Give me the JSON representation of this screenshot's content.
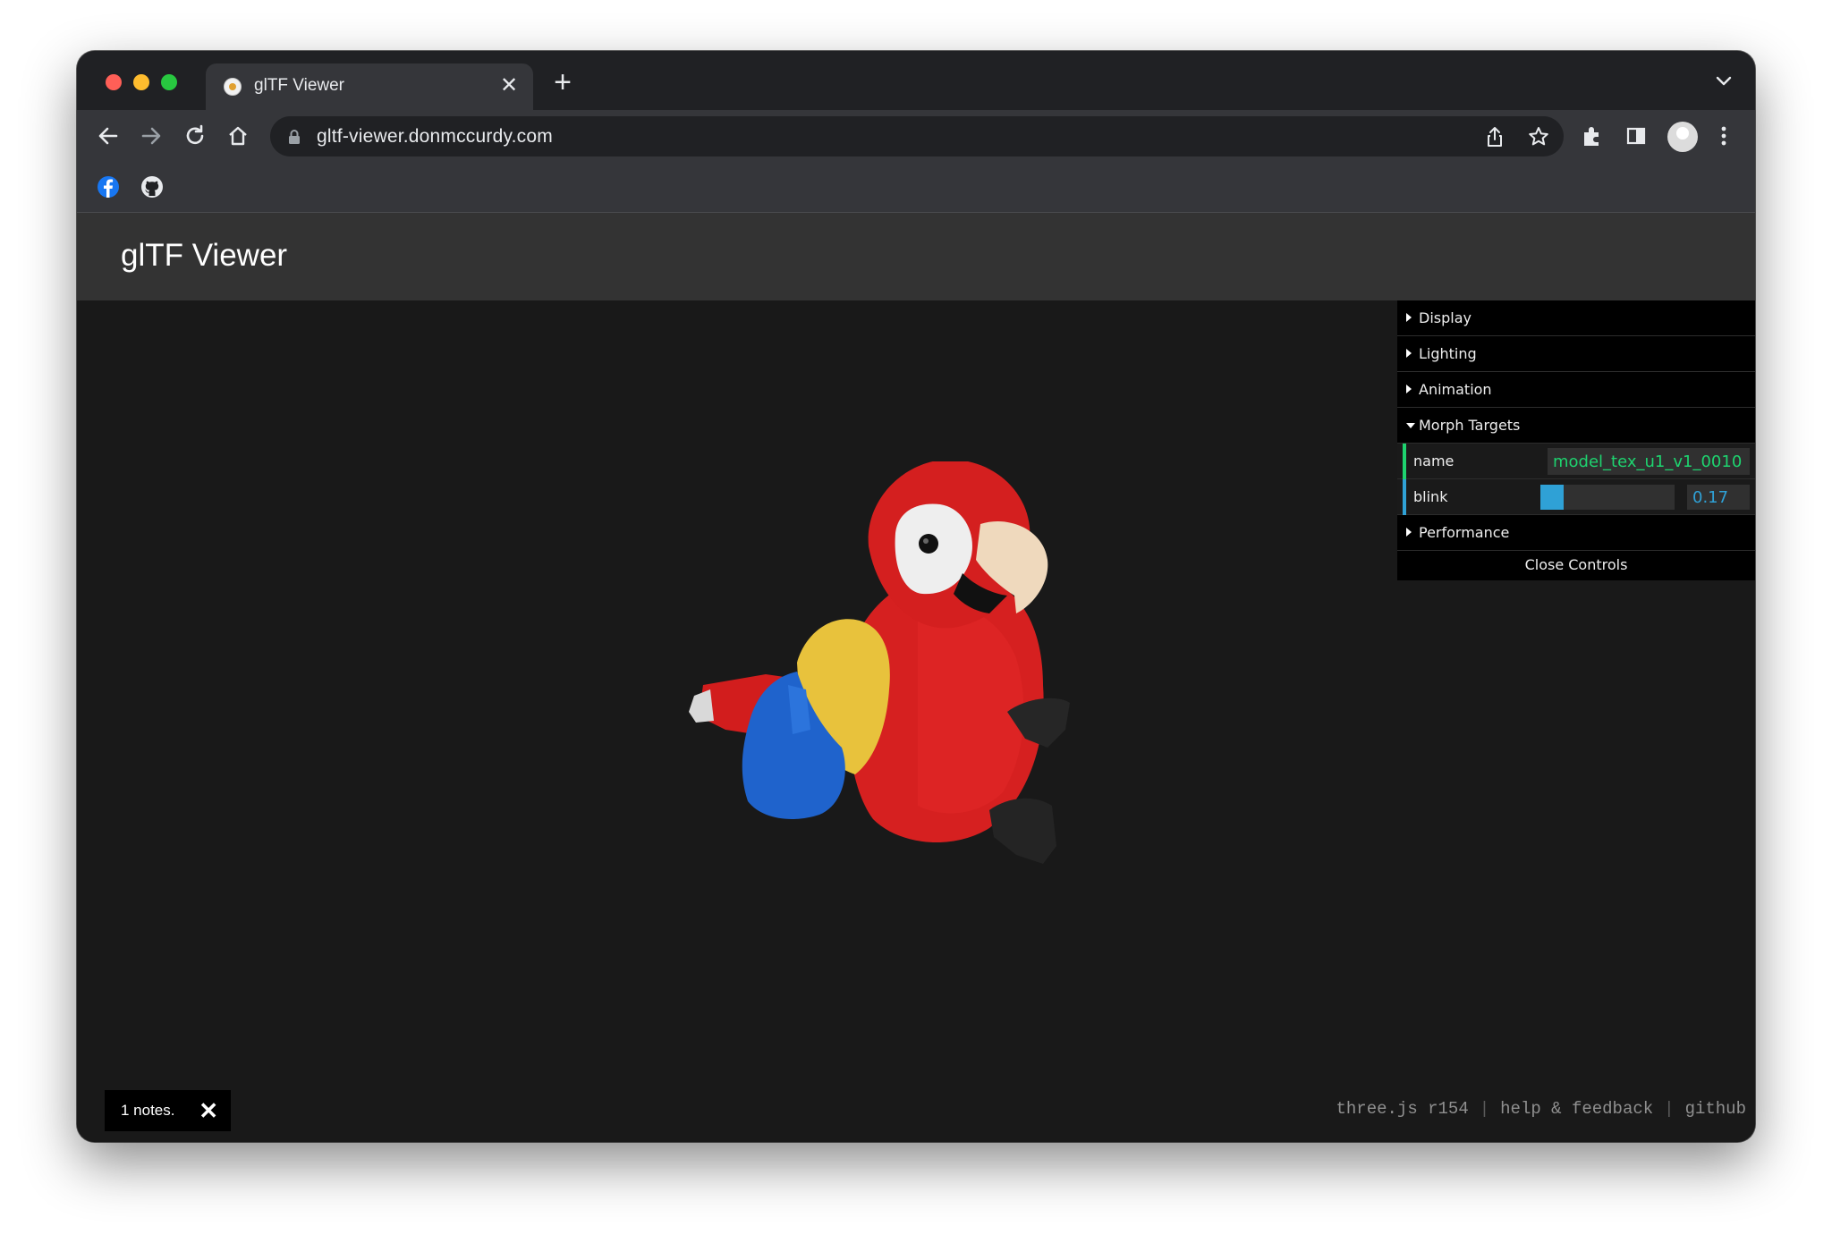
{
  "browser": {
    "tab_title": "glTF Viewer",
    "tab_close": "✕",
    "new_tab": "+",
    "url": "gltf-viewer.donmccurdy.com"
  },
  "page": {
    "title": "glTF Viewer"
  },
  "controls": {
    "folders": {
      "display": "Display",
      "lighting": "Lighting",
      "animation": "Animation",
      "morph_targets": "Morph Targets",
      "performance": "Performance"
    },
    "morph_rows": {
      "name_label": "name",
      "name_value": "model_tex_u1_v1_0010",
      "blink_label": "blink",
      "blink_value": "0.17",
      "blink_fraction": 0.17
    },
    "close_label": "Close Controls"
  },
  "notes": {
    "text": "1 notes.",
    "close": "✕"
  },
  "footer": {
    "version": "three.js r154",
    "help": "help & feedback",
    "github": "github"
  },
  "icons": [
    "facebook-icon",
    "github-icon",
    "lock-icon",
    "share-icon",
    "star-icon",
    "extensions-icon",
    "sidepanel-icon",
    "avatar",
    "menu-icon",
    "back-icon",
    "forward-icon",
    "reload-icon",
    "home-icon",
    "chevron-down-icon"
  ],
  "colors": {
    "gui_accent_text": "#1ed36f",
    "gui_accent_number": "#2fa1d6"
  }
}
